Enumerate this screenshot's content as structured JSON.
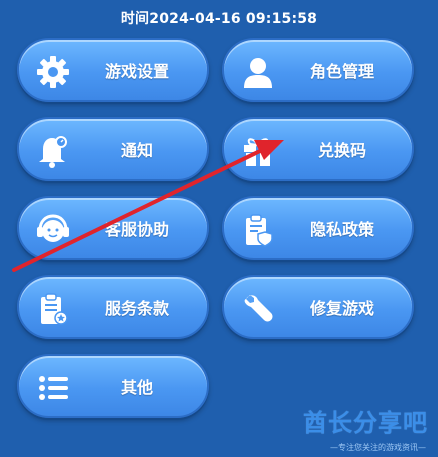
{
  "timestamp": "时间2024-04-16 09:15:58",
  "menu": {
    "settings": "游戏设置",
    "role": "角色管理",
    "notice": "通知",
    "redeem": "兑换码",
    "support": "客服协助",
    "privacy": "隐私政策",
    "terms": "服务条款",
    "repair": "修复游戏",
    "other": "其他"
  },
  "watermark": {
    "title": "酋长分享吧",
    "subtitle": "—专注您关注的游戏资讯—"
  },
  "colors": {
    "background": "#1f5fae",
    "button": "#4a97f2",
    "annotation_arrow": "#e0242c"
  },
  "icons": [
    "gear-icon",
    "person-icon",
    "bell-icon",
    "gift-icon",
    "headset-icon",
    "clipboard-shield-icon",
    "document-badge-icon",
    "wrench-icon",
    "list-icon"
  ]
}
